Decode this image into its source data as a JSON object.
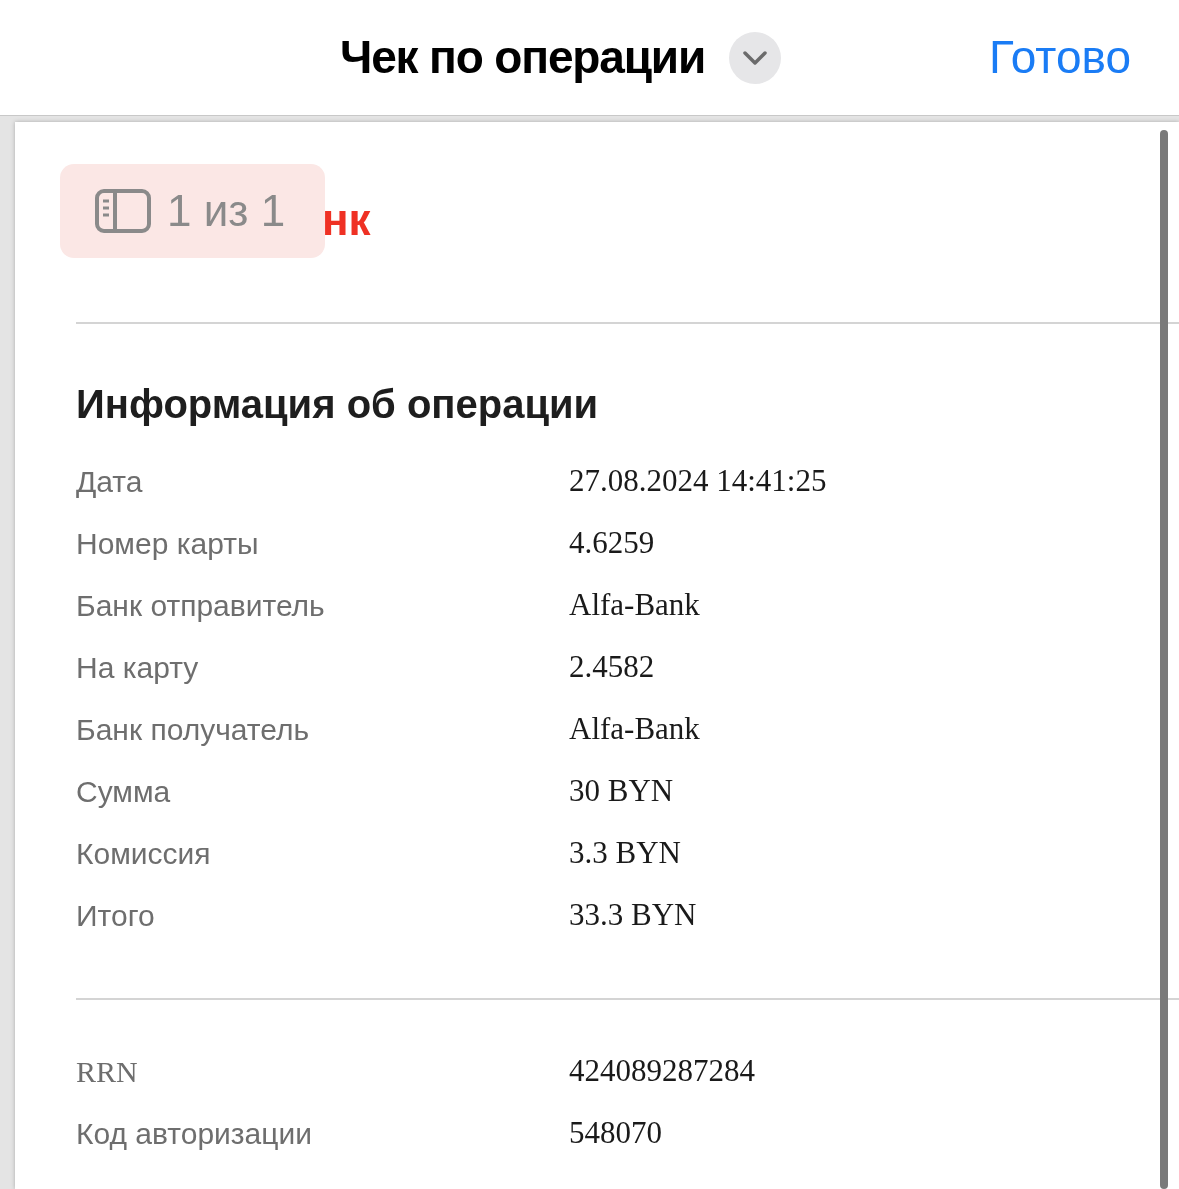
{
  "header": {
    "title": "Чек по операции",
    "done": "Готово"
  },
  "page_badge": {
    "text": "1 из 1"
  },
  "logo": {
    "text": "нк"
  },
  "section": {
    "title": "Информация об операции",
    "rows": [
      {
        "label": "Дата",
        "value": "27.08.2024 14:41:25"
      },
      {
        "label": "Номер карты",
        "value": "4.6259"
      },
      {
        "label": "Банк отправитель",
        "value": "Alfa-Bank"
      },
      {
        "label": "На карту",
        "value": "2.4582"
      },
      {
        "label": "Банк получатель",
        "value": "Alfa-Bank"
      },
      {
        "label": "Сумма",
        "value": "30 BYN"
      },
      {
        "label": "Комиссия",
        "value": "3.3 BYN"
      },
      {
        "label": "Итого",
        "value": "33.3 BYN"
      }
    ]
  },
  "codes": [
    {
      "kind": "serif",
      "label": "RRN",
      "value": "424089287284"
    },
    {
      "kind": "sans",
      "label": "Код авторизации",
      "value": "548070"
    }
  ]
}
